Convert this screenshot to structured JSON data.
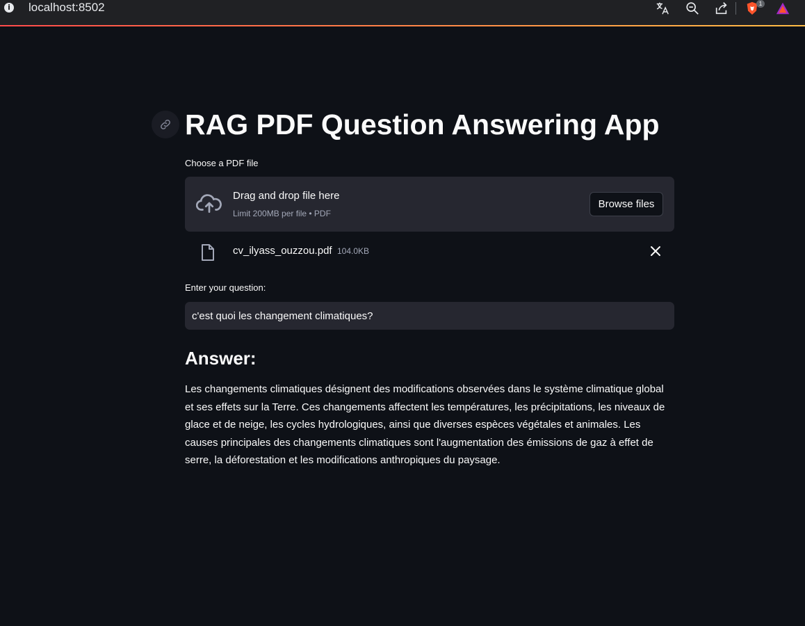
{
  "browser": {
    "url": "localhost:8502",
    "brave_badge_count": "1",
    "icons": [
      "info-icon",
      "translate-icon",
      "zoom-out-icon",
      "share-icon",
      "brave-shield-icon",
      "brave-rewards-icon"
    ]
  },
  "app": {
    "title": "RAG PDF Question Answering App",
    "anchor_icon": "link-icon"
  },
  "uploader": {
    "label": "Choose a PDF file",
    "drop_text": "Drag and drop file here",
    "limit_text": "Limit 200MB per file • PDF",
    "browse_label": "Browse files",
    "icon": "cloud-upload-icon"
  },
  "uploaded_file": {
    "name": "cv_ilyass_ouzzou.pdf",
    "size": "104.0KB",
    "icon": "file-icon"
  },
  "question": {
    "label": "Enter your question:",
    "value": "c'est quoi les changement climatiques?"
  },
  "answer": {
    "heading": "Answer:",
    "text": "Les changements climatiques désignent des modifications observées dans le système climatique global et ses effets sur la Terre. Ces changements affectent les températures, les précipitations, les niveaux de glace et de neige, les cycles hydrologiques, ainsi que diverses espèces végétales et animales. Les causes principales des changements climatiques sont l'augmentation des émissions de gaz à effet de serre, la déforestation et les modifications anthropiques du paysage."
  },
  "colors": {
    "background": "#0e1117",
    "widget_bg": "#262730",
    "text": "#fafafa",
    "muted": "#a3a8b8",
    "accent_start": "#ff4b4b",
    "accent_end": "#ffbd45"
  }
}
